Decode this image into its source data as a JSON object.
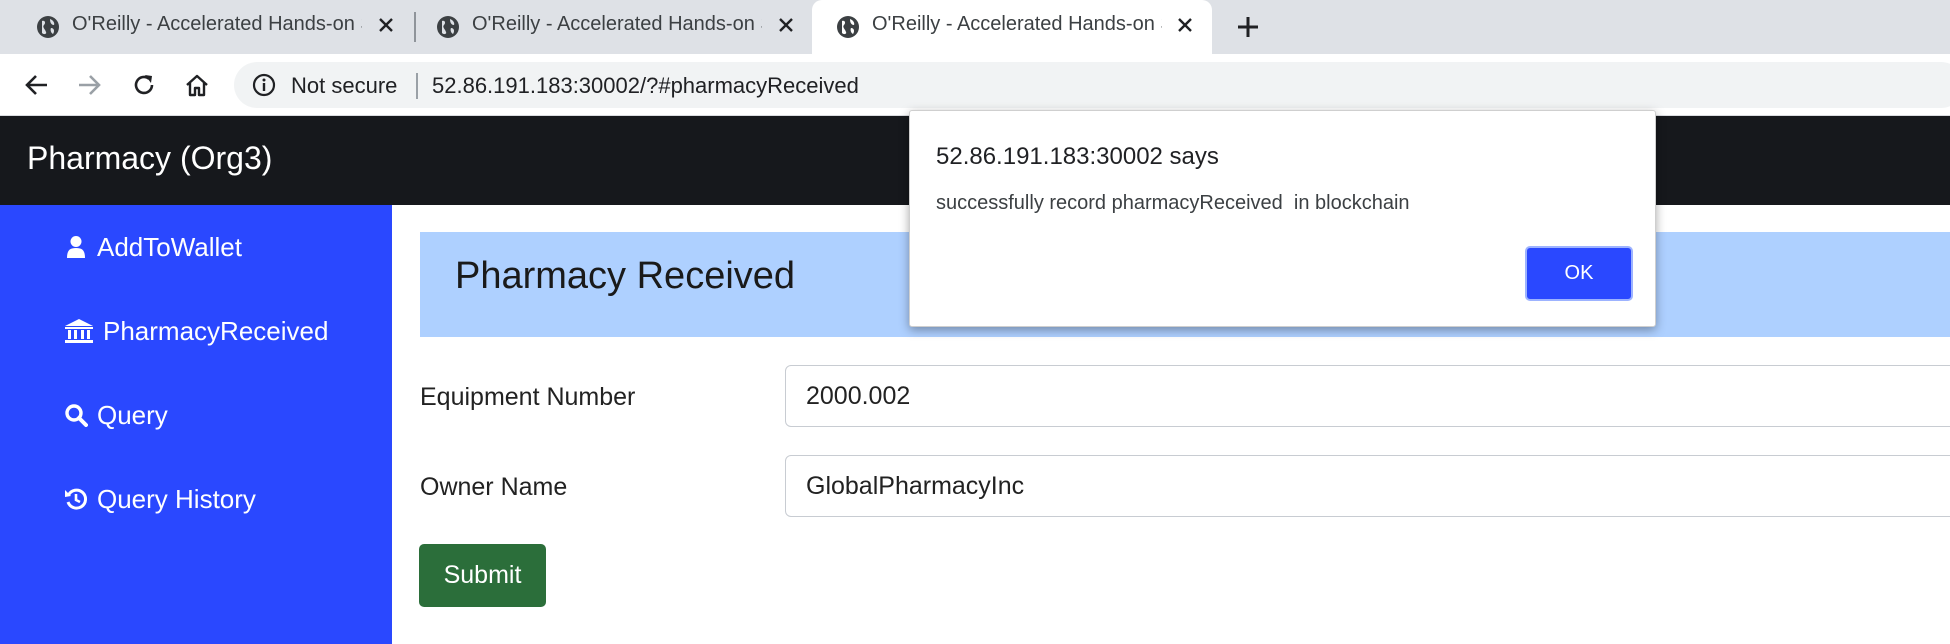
{
  "browser": {
    "tabs": [
      {
        "title": "O'Reilly - Accelerated Hands-on S",
        "icon": "globe-icon",
        "active": false
      },
      {
        "title": "O'Reilly - Accelerated Hands-on S",
        "icon": "globe-icon",
        "active": false
      },
      {
        "title": "O'Reilly - Accelerated Hands-on S",
        "icon": "globe-icon",
        "active": true
      }
    ],
    "security_label": "Not secure",
    "url": "52.86.191.183:30002/?#pharmacyReceived"
  },
  "header": {
    "title": "Pharmacy (Org3)"
  },
  "sidebar": {
    "items": [
      {
        "label": "AddToWallet",
        "icon": "user-icon"
      },
      {
        "label": "PharmacyReceived",
        "icon": "bank-icon"
      },
      {
        "label": "Query",
        "icon": "search-icon"
      },
      {
        "label": "Query History",
        "icon": "history-icon"
      }
    ]
  },
  "main": {
    "heading": "Pharmacy Received",
    "fields": [
      {
        "label": "Equipment Number",
        "value": "2000.002"
      },
      {
        "label": "Owner Name",
        "value": "GlobalPharmacyInc"
      }
    ],
    "submit_label": "Submit"
  },
  "dialog": {
    "origin": "52.86.191.183:30002 says",
    "message": "successfully record pharmacyReceived  in blockchain",
    "ok_label": "OK"
  },
  "colors": {
    "header_bg": "#16181c",
    "sidebar_bg": "#2a48ff",
    "banner_bg": "#aed0ff",
    "submit_bg": "#2b6e3a",
    "ok_bg": "#2a48ff"
  }
}
